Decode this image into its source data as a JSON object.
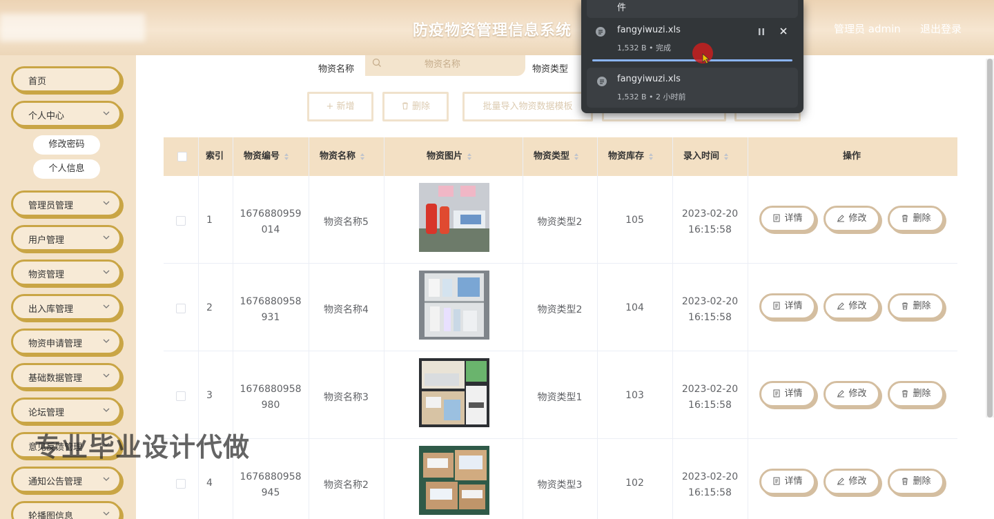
{
  "header": {
    "title": "防疫物资管理信息系统",
    "admin": "管理员 admin",
    "logout": "退出登录"
  },
  "sidebar": {
    "home": "首页",
    "personal": "个人中心",
    "personal_sub": [
      "修改密码",
      "个人信息"
    ],
    "items": [
      "管理员管理",
      "用户管理",
      "物资管理",
      "出入库管理",
      "物资申请管理",
      "基础数据管理",
      "论坛管理",
      "意见反馈管理",
      "通知公告管理",
      "轮播图信息"
    ]
  },
  "search": {
    "name_label": "物资名称",
    "name_placeholder": "物资名称",
    "type_label": "物资类型"
  },
  "actions": {
    "add": "+ 新增",
    "delete": "删除",
    "import_template": "批量导入物资数据模板"
  },
  "table": {
    "headers": [
      "索引",
      "物资编号",
      "物资名称",
      "物资图片",
      "物资类型",
      "物资库存",
      "录入时间",
      "操作"
    ],
    "rows": [
      {
        "index": "1",
        "code1": "1676880959",
        "code2": "014",
        "name": "物资名称5",
        "type": "物资类型2",
        "stock": "105",
        "date": "2023-02-20",
        "time": "16:15:58"
      },
      {
        "index": "2",
        "code1": "1676880958",
        "code2": "931",
        "name": "物资名称4",
        "type": "物资类型2",
        "stock": "104",
        "date": "2023-02-20",
        "time": "16:15:58"
      },
      {
        "index": "3",
        "code1": "1676880958",
        "code2": "980",
        "name": "物资名称3",
        "type": "物资类型1",
        "stock": "103",
        "date": "2023-02-20",
        "time": "16:15:58"
      },
      {
        "index": "4",
        "code1": "1676880958",
        "code2": "945",
        "name": "物资名称2",
        "type": "物资类型3",
        "stock": "102",
        "date": "2023-02-20",
        "time": "16:15:58"
      }
    ],
    "ops": {
      "detail": "详情",
      "edit": "修改",
      "delete": "删除"
    }
  },
  "download_popup": {
    "top_text": "件",
    "items": [
      {
        "name": "fangyiwuzi.xls",
        "meta": "1,532 B • 完成"
      },
      {
        "name": "fangyiwuzi.xls",
        "meta": "1,532 B • 2 小时前"
      }
    ]
  },
  "watermark": "专业毕业设计代做"
}
